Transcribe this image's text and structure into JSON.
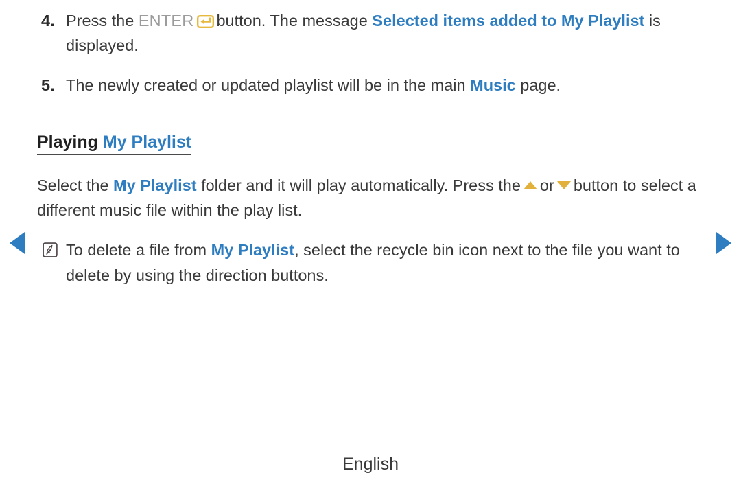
{
  "document": {
    "language_label": "English"
  },
  "steps": [
    {
      "number": "4.",
      "text_before_key": "Press the",
      "key_label": "ENTER",
      "key_icon": "enter-key-icon",
      "text_after_key": "button. The message",
      "highlight": "Selected items added to My Playlist",
      "text_end": "is displayed."
    },
    {
      "number": "5.",
      "text_before": "The newly created or updated playlist will be in the main",
      "highlight": "Music",
      "text_after": "page."
    }
  ],
  "section": {
    "heading_plain": "Playing",
    "heading_highlight": "My Playlist",
    "paragraph": {
      "p1": "Select the",
      "highlight1": "My Playlist",
      "p2": "folder and it will play automatically. Press the",
      "icon_up": "triangle-up-icon",
      "p3": "or",
      "icon_down": "triangle-down-icon",
      "p4": "button to select a different music file within the play list."
    },
    "note": {
      "icon": "note-pen-icon",
      "n1": "To delete a file from",
      "highlight1": "My Playlist",
      "n2": ", select the recycle bin icon next to the file you want to delete by using the direction buttons."
    }
  },
  "navigation": {
    "prev_label": "previous-page",
    "next_label": "next-page"
  },
  "colors": {
    "link_blue": "#2d7dc0",
    "accent_gold": "#e2b13c",
    "key_grey": "#9c9c9c",
    "body_text": "#3a3a3a"
  }
}
